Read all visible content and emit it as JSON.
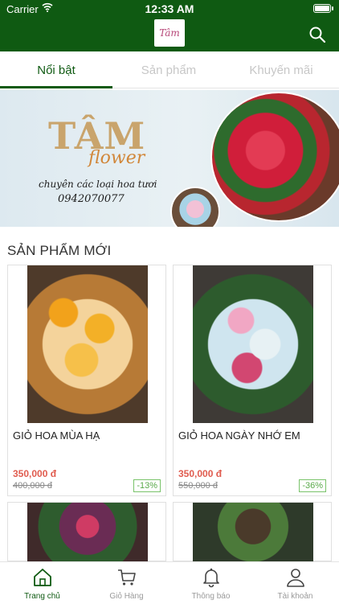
{
  "status_bar": {
    "carrier": "Carrier",
    "time": "12:33 AM"
  },
  "header": {
    "logo_text": "Tâm",
    "search_icon": "search-icon"
  },
  "tabs": [
    {
      "label": "Nổi bật",
      "active": true
    },
    {
      "label": "Sản phẩm",
      "active": false
    },
    {
      "label": "Khuyến mãi",
      "active": false
    }
  ],
  "banner": {
    "brand": "TÂM",
    "sub_brand": "flower",
    "slogan": "chuyên các loại hoa tươi",
    "phone": "0942070077"
  },
  "section": {
    "title": "SẢN PHẨM MỚI"
  },
  "products": [
    {
      "name": "GIỎ HOA MÙA HẠ",
      "price": "350,000 đ",
      "old_price": "400,000 đ",
      "discount": "-13%"
    },
    {
      "name": "GIỎ HOA NGÀY NHỚ EM",
      "price": "350,000 đ",
      "old_price": "550,000 đ",
      "discount": "-36%"
    },
    {
      "name": "",
      "price": "",
      "old_price": "",
      "discount": ""
    },
    {
      "name": "",
      "price": "",
      "old_price": "",
      "discount": ""
    }
  ],
  "bottom_nav": [
    {
      "label": "Trang chủ",
      "icon": "home-icon",
      "active": true
    },
    {
      "label": "Giỏ Hàng",
      "icon": "cart-icon",
      "active": false
    },
    {
      "label": "Thông báo",
      "icon": "bell-icon",
      "active": false
    },
    {
      "label": "Tài khoản",
      "icon": "user-icon",
      "active": false
    }
  ],
  "colors": {
    "brand_green": "#0f5a12",
    "price_red": "#e05c4f",
    "badge_green": "#58a948"
  }
}
